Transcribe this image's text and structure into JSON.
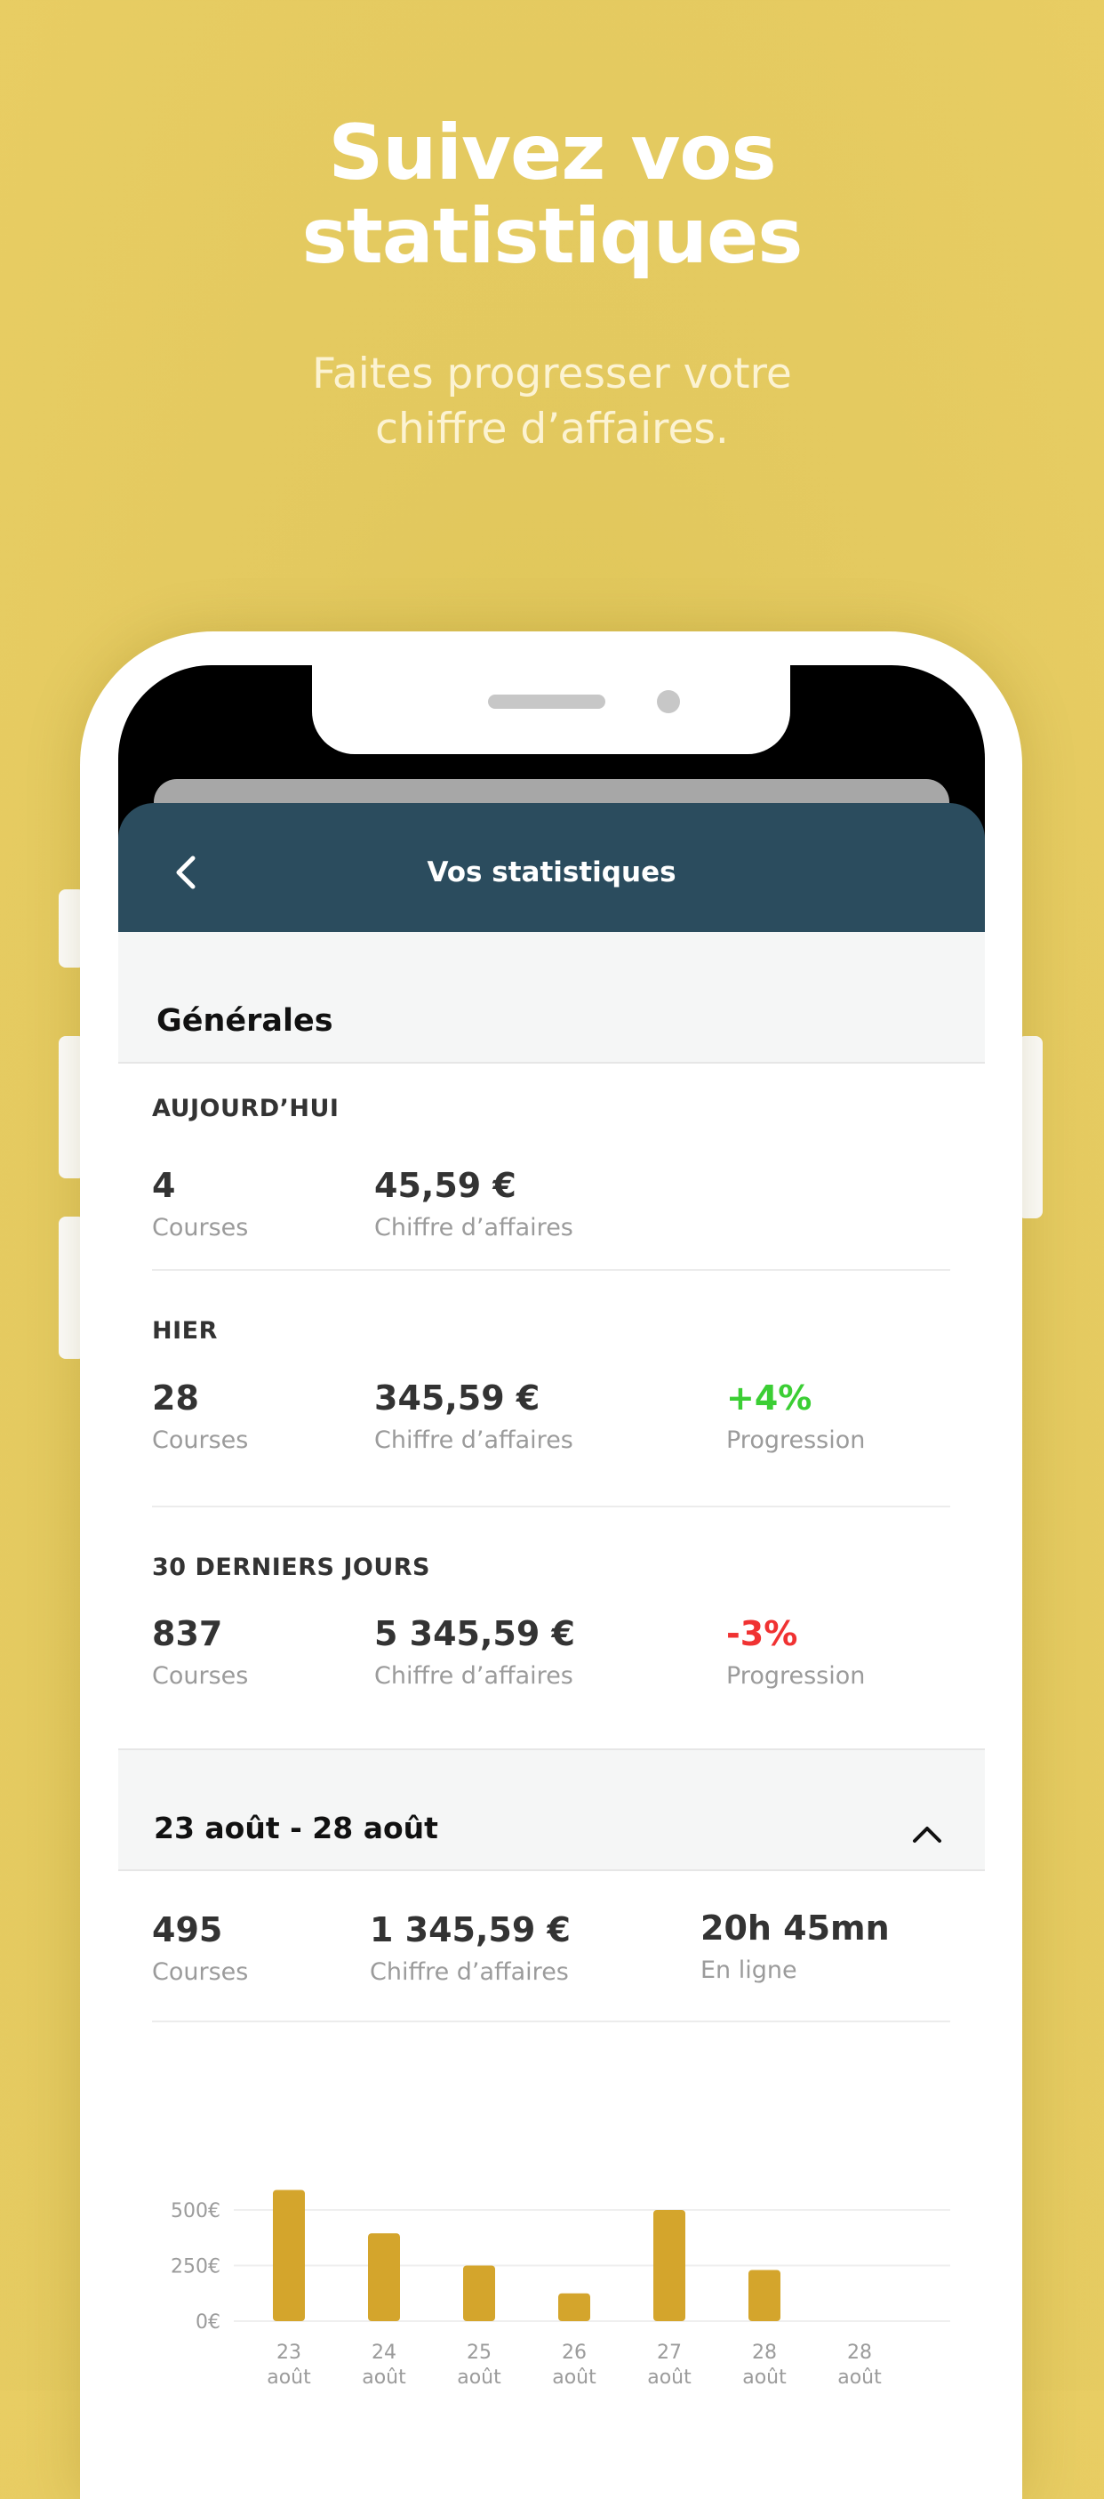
{
  "promo": {
    "title_line1": "Suivez vos",
    "title_line2": "statistiques",
    "subtitle_line1": "Faites progresser votre",
    "subtitle_line2": "chiffre d’affaires."
  },
  "header": {
    "title": "Vos statistiques"
  },
  "general": {
    "title": "Générales",
    "today": {
      "label": "AUJOURD’HUI",
      "rides_value": "4",
      "rides_label": "Courses",
      "revenue_value": "45,59 €",
      "revenue_label": "Chiffre d’affaires"
    },
    "yesterday": {
      "label": "HIER",
      "rides_value": "28",
      "rides_label": "Courses",
      "revenue_value": "345,59 €",
      "revenue_label": "Chiffre d’affaires",
      "progress_value": "+4%",
      "progress_label": "Progression"
    },
    "last30": {
      "label": "30 DERNIERS JOURS",
      "rides_value": "837",
      "rides_label": "Courses",
      "revenue_value": "5 345,59 €",
      "revenue_label": "Chiffre d’affaires",
      "progress_value": "-3%",
      "progress_label": "Progression"
    }
  },
  "period": {
    "title": "23 août - 28 août",
    "rides_value": "495",
    "rides_label": "Courses",
    "revenue_value": "1 345,59 €",
    "revenue_label": "Chiffre d’affaires",
    "online_value": "20h 45mn",
    "online_label": "En ligne"
  },
  "colors": {
    "background": "#e5ca5f",
    "header": "#2b4c5e",
    "bar": "#d4a52c",
    "positive": "#3bce34",
    "negative": "#f03232"
  },
  "chart_data": {
    "type": "bar",
    "categories": [
      [
        "23",
        "août"
      ],
      [
        "24",
        "août"
      ],
      [
        "25",
        "août"
      ],
      [
        "26",
        "août"
      ],
      [
        "27",
        "août"
      ],
      [
        "28",
        "août"
      ],
      [
        "28",
        "août"
      ]
    ],
    "values": [
      590,
      395,
      250,
      125,
      500,
      230,
      0
    ],
    "ylim": [
      0,
      500
    ],
    "yticks": [
      0,
      250,
      500
    ],
    "ytick_labels": [
      "0€",
      "250€",
      "500€"
    ],
    "grid": true
  }
}
